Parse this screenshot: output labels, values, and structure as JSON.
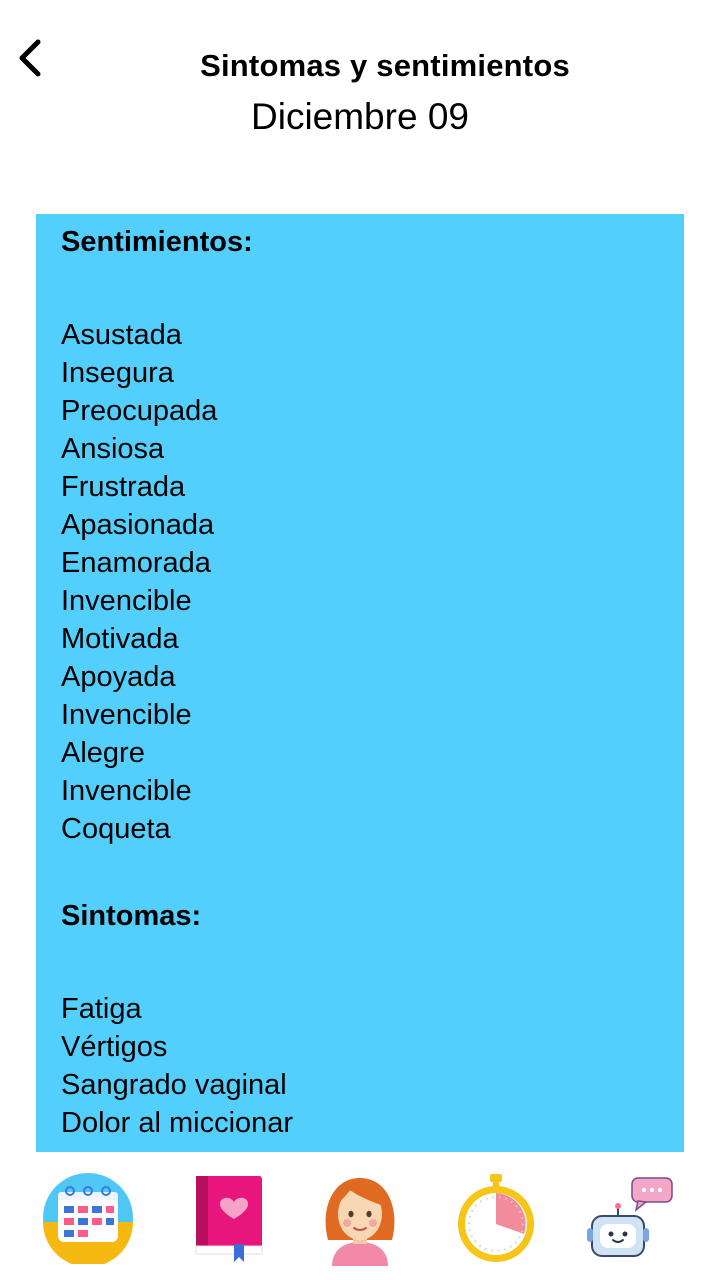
{
  "header": {
    "title": "Sintomas y sentimientos",
    "date": "Diciembre 09"
  },
  "feelings": {
    "heading": "Sentimientos:",
    "items": [
      "Asustada",
      "Insegura",
      "Preocupada",
      "Ansiosa",
      "Frustrada",
      "Apasionada",
      "Enamorada",
      "Invencible",
      "Motivada",
      "Apoyada",
      "Invencible",
      "Alegre",
      "Invencible",
      "Coqueta"
    ]
  },
  "symptoms": {
    "heading": "Sintomas:",
    "items": [
      "Fatiga",
      "Vértigos",
      "Sangrado vaginal",
      "Dolor al miccionar"
    ]
  },
  "colors": {
    "card_background": "#53cffe"
  },
  "nav": [
    {
      "icon": "calendar-icon"
    },
    {
      "icon": "diary-icon"
    },
    {
      "icon": "avatar-icon"
    },
    {
      "icon": "timer-icon"
    },
    {
      "icon": "chatbot-icon"
    }
  ]
}
